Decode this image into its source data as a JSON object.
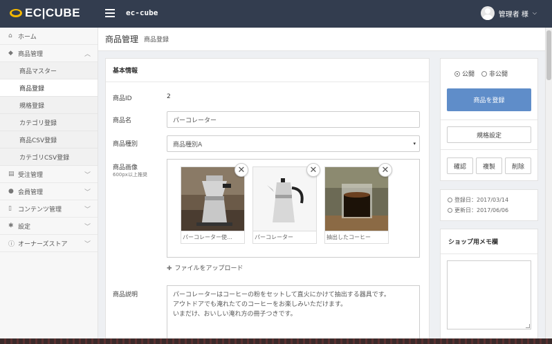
{
  "header": {
    "logo": "EC|CUBE",
    "shop_name": "ec-cube",
    "user_name": "管理者 様"
  },
  "sidebar": {
    "items": [
      {
        "label": "ホーム",
        "icon": "home-icon"
      },
      {
        "label": "商品管理",
        "icon": "tag-icon",
        "expanded": true
      },
      {
        "label": "受注管理",
        "icon": "cart-icon"
      },
      {
        "label": "会員管理",
        "icon": "user-icon"
      },
      {
        "label": "コンテンツ管理",
        "icon": "file-icon"
      },
      {
        "label": "設定",
        "icon": "gear-icon"
      },
      {
        "label": "オーナーズストア",
        "icon": "info-icon"
      }
    ],
    "sub_items": [
      {
        "label": "商品マスター",
        "active": false
      },
      {
        "label": "商品登録",
        "active": true
      },
      {
        "label": "規格登録",
        "active": false
      },
      {
        "label": "カテゴリ登録",
        "active": false
      },
      {
        "label": "商品CSV登録",
        "active": false
      },
      {
        "label": "カテゴリCSV登録",
        "active": false
      }
    ]
  },
  "title": {
    "main": "商品管理",
    "sub": "商品登録"
  },
  "form": {
    "section_title": "基本情報",
    "id_label": "商品ID",
    "id_value": "2",
    "name_label": "商品名",
    "name_value": "パーコレーター",
    "type_label": "商品種別",
    "type_value": "商品種別A",
    "image_label": "商品画像",
    "image_hint": "600px以上推奨",
    "images": [
      {
        "caption": "パーコレーター使…"
      },
      {
        "caption": "パーコレーター"
      },
      {
        "caption": "抽出したコーヒー"
      }
    ],
    "upload_label": "ファイルをアップロード",
    "desc_label": "商品説明",
    "desc_lines": [
      "パーコレーターはコーヒーの粉をセットして直火にかけて抽出する器具です。",
      "アウトドアでも淹れたてのコーヒーをお楽しみいただけます。",
      "いまだけ、おいしい淹れ方の冊子つきです。"
    ]
  },
  "status_panel": {
    "public_label": "公開",
    "private_label": "非公開",
    "selected": "public",
    "register_button": "商品を登録",
    "stock_button": "規格設定",
    "delete_button": "削除",
    "copy_button": "複製",
    "confirm_button": "確認"
  },
  "dates": {
    "created": "登録日：2017/03/14",
    "updated": "更新日：2017/06/06"
  },
  "memo": {
    "title": "ショップ用メモ欄"
  },
  "colors": {
    "header_bg": "#333d4f",
    "logo_accent": "#f5b800",
    "primary_button": "#5f8dc9"
  }
}
